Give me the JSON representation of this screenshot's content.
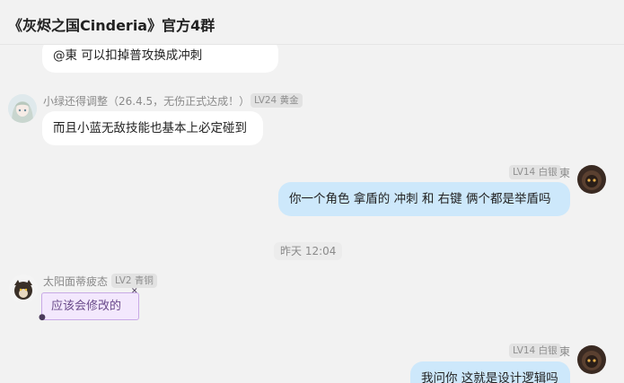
{
  "header": {
    "title": "《灰烬之国Cinderia》官方4群"
  },
  "messages": {
    "m0": {
      "text": "@東 可以扣掉普攻换成冲刺"
    },
    "m1": {
      "sender": "小绿还得调整（26.4.5，无伤正式达成！）",
      "badge": "LV24 黄金",
      "text": "而且小蓝无敌技能也基本上必定碰到"
    },
    "m2": {
      "sender": "東",
      "badge": "LV14 白银",
      "text": "你一个角色 拿盾的  冲刺 和 右键 俩个都是举盾吗"
    },
    "time": "昨天 12:04",
    "m3": {
      "sender": "太阳面蒂疲态",
      "badge": "LV2 青铜",
      "text": "应该会修改的"
    },
    "m4": {
      "sender": "東",
      "badge": "LV14 白银",
      "text": "我问你 这就是设计逻辑吗"
    }
  },
  "icons": {
    "avatar_green": "anime-girl-avatar",
    "avatar_dong": "dark-character-avatar",
    "avatar_sun": "dog-character-avatar"
  },
  "colors": {
    "incoming_bubble": "#ffffff",
    "outgoing_bubble": "#cde8fb",
    "special_bubble": "#f3e8fd"
  }
}
